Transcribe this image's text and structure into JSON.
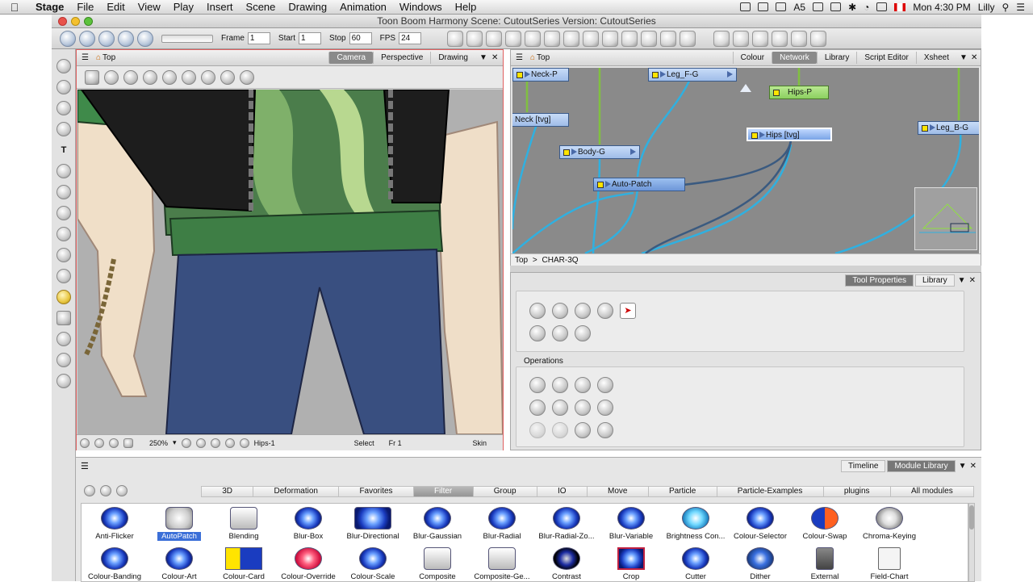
{
  "menubar": {
    "apple": "",
    "app_name": "Stage",
    "items": [
      "File",
      "Edit",
      "View",
      "Play",
      "Insert",
      "Scene",
      "Drawing",
      "Animation",
      "Windows",
      "Help"
    ],
    "clock": "Mon 4:30 PM",
    "user": "Lilly",
    "status_icons": [
      "dropbox-icon",
      "display-icon",
      "adobe-icon",
      "A5",
      "shield-icon",
      "battery-bolt-icon",
      "bluetooth-icon",
      "wifi-icon",
      "battery-icon",
      "flag-icon"
    ]
  },
  "window": {
    "title": "Toon Boom Harmony Scene: CutoutSeries Version: CutoutSeries"
  },
  "toolbar": {
    "frame_label": "Frame",
    "frame_value": "1",
    "start_label": "Start",
    "start_value": "1",
    "stop_label": "Stop",
    "stop_value": "60",
    "fps_label": "FPS",
    "fps_value": "24"
  },
  "camera_view": {
    "breadcrumb": "Top",
    "tabs": [
      "Camera",
      "Perspective",
      "Drawing"
    ],
    "active_tab": "Camera",
    "zoom": "250%",
    "layer": "Hips-1",
    "tool": "Select",
    "frame": "Fr 1",
    "mode": "Skin"
  },
  "node_view": {
    "breadcrumb": "Top",
    "tabs": [
      "Colour",
      "Network",
      "Library",
      "Script Editor",
      "Xsheet"
    ],
    "active_tab": "Network",
    "path": [
      "Top",
      ">",
      "CHAR-3Q"
    ],
    "nodes": [
      {
        "label": "Neck-P"
      },
      {
        "label": "Leg_F-G"
      },
      {
        "label": "Hips-P"
      },
      {
        "label": "Neck [tvg]"
      },
      {
        "label": "Hips [tvg]"
      },
      {
        "label": "Leg_B-G"
      },
      {
        "label": "Body-G"
      },
      {
        "label": "Auto-Patch"
      }
    ]
  },
  "tool_properties": {
    "tabs": [
      "Tool Properties",
      "Library"
    ],
    "active_tab": "Tool Properties",
    "operations_label": "Operations"
  },
  "module_library": {
    "tabs": [
      "Timeline",
      "Module Library"
    ],
    "active_tab": "Module Library",
    "categories": [
      "3D",
      "Deformation",
      "Favorites",
      "Filter",
      "Group",
      "IO",
      "Move",
      "Particle",
      "Particle-Examples",
      "plugins",
      "All modules"
    ],
    "active_category": "Filter",
    "modules_row1": [
      "Anti-Flicker",
      "AutoPatch",
      "Blending",
      "Blur-Box",
      "Blur-Directional",
      "Blur-Gaussian",
      "Blur-Radial",
      "Blur-Radial-Zo...",
      "Blur-Variable",
      "Brightness Con...",
      "Colour-Selector",
      "Colour-Swap",
      "Chroma-Keying"
    ],
    "modules_row2": [
      "Colour-Banding",
      "Colour-Art",
      "Colour-Card",
      "Colour-Override",
      "Colour-Scale",
      "Composite",
      "Composite-Ge...",
      "Contrast",
      "Crop",
      "Cutter",
      "Dither",
      "External",
      "Field-Chart"
    ],
    "selected_module": "AutoPatch"
  }
}
